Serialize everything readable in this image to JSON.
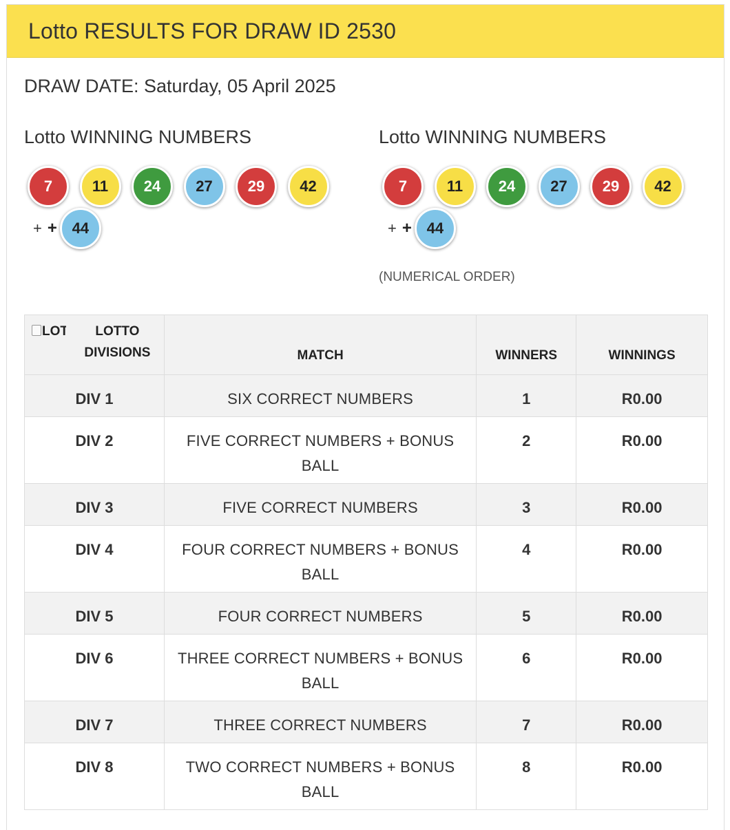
{
  "header": {
    "title": "Lotto RESULTS FOR DRAW ID 2530"
  },
  "draw_date": "DRAW DATE: Saturday, 05 April 2025",
  "left_column": {
    "title": "Lotto WINNING NUMBERS",
    "balls": [
      {
        "value": "7",
        "color": "#d33d3d"
      },
      {
        "value": "11",
        "color": "#f7de46"
      },
      {
        "value": "24",
        "color": "#3f9b3f"
      },
      {
        "value": "27",
        "color": "#7fc4e8"
      },
      {
        "value": "29",
        "color": "#d33d3d"
      },
      {
        "value": "42",
        "color": "#f7de46"
      }
    ],
    "plus_a": "+",
    "plus_b": "+",
    "bonus": {
      "value": "44",
      "color": "#7fc4e8"
    }
  },
  "right_column": {
    "title": "Lotto WINNING NUMBERS",
    "balls": [
      {
        "value": "7",
        "color": "#d33d3d"
      },
      {
        "value": "11",
        "color": "#f7de46"
      },
      {
        "value": "24",
        "color": "#3f9b3f"
      },
      {
        "value": "27",
        "color": "#7fc4e8"
      },
      {
        "value": "29",
        "color": "#d33d3d"
      },
      {
        "value": "42",
        "color": "#f7de46"
      }
    ],
    "plus_a": "+",
    "plus_b": "+",
    "bonus": {
      "value": "44",
      "color": "#7fc4e8"
    },
    "note": "(NUMERICAL ORDER)"
  },
  "table": {
    "broken_image_alt": "LOTTO",
    "headers": {
      "divisions": "LOTTO DIVISIONS",
      "match": "MATCH",
      "winners": "WINNERS",
      "winnings": "WINNINGS"
    },
    "rows": [
      {
        "div": "DIV 1",
        "match": "SIX CORRECT NUMBERS",
        "winners": "1",
        "winnings": "R0.00"
      },
      {
        "div": "DIV 2",
        "match": "FIVE CORRECT NUMBERS + BONUS BALL",
        "winners": "2",
        "winnings": "R0.00"
      },
      {
        "div": "DIV 3",
        "match": "FIVE CORRECT NUMBERS",
        "winners": "3",
        "winnings": "R0.00"
      },
      {
        "div": "DIV 4",
        "match": "FOUR CORRECT NUMBERS + BONUS BALL",
        "winners": "4",
        "winnings": "R0.00"
      },
      {
        "div": "DIV 5",
        "match": "FOUR CORRECT NUMBERS",
        "winners": "5",
        "winnings": "R0.00"
      },
      {
        "div": "DIV 6",
        "match": "THREE CORRECT NUMBERS + BONUS BALL",
        "winners": "6",
        "winnings": "R0.00"
      },
      {
        "div": "DIV 7",
        "match": "THREE CORRECT NUMBERS",
        "winners": "7",
        "winnings": "R0.00"
      },
      {
        "div": "DIV 8",
        "match": "TWO CORRECT NUMBERS + BONUS BALL",
        "winners": "8",
        "winnings": "R0.00"
      }
    ]
  }
}
